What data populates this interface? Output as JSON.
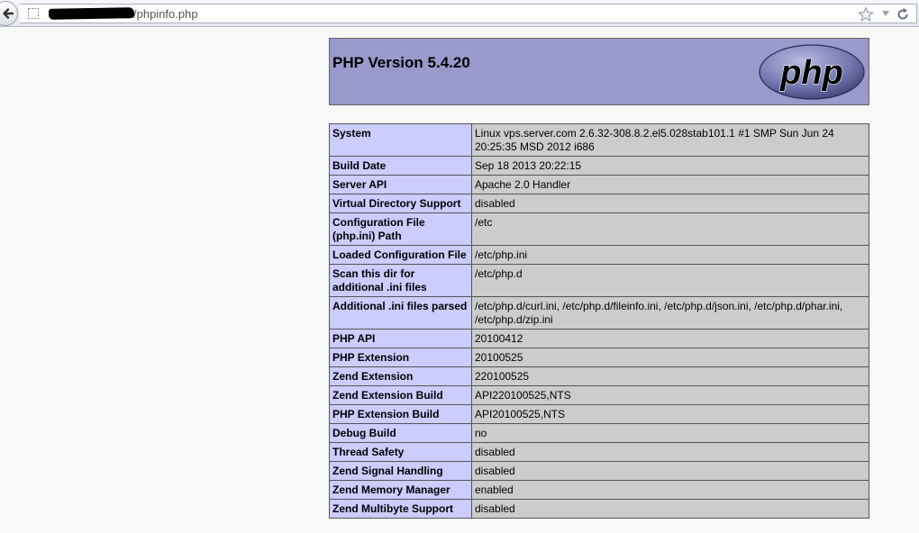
{
  "browser": {
    "url_path": "/phpinfo.php"
  },
  "header": {
    "title": "PHP Version 5.4.20",
    "logo_text": "php"
  },
  "rows": [
    {
      "key": "System",
      "value": "Linux vps.server.com 2.6.32-308.8.2.el5.028stab101.1 #1 SMP Sun Jun 24 20:25:35 MSD 2012 i686"
    },
    {
      "key": "Build Date",
      "value": "Sep 18 2013 20:22:15"
    },
    {
      "key": "Server API",
      "value": "Apache 2.0 Handler"
    },
    {
      "key": "Virtual Directory Support",
      "value": "disabled"
    },
    {
      "key": "Configuration File (php.ini) Path",
      "value": "/etc"
    },
    {
      "key": "Loaded Configuration File",
      "value": "/etc/php.ini"
    },
    {
      "key": "Scan this dir for additional .ini files",
      "value": "/etc/php.d"
    },
    {
      "key": "Additional .ini files parsed",
      "value": "/etc/php.d/curl.ini, /etc/php.d/fileinfo.ini, /etc/php.d/json.ini, /etc/php.d/phar.ini, /etc/php.d/zip.ini"
    },
    {
      "key": "PHP API",
      "value": "20100412"
    },
    {
      "key": "PHP Extension",
      "value": "20100525"
    },
    {
      "key": "Zend Extension",
      "value": "220100525"
    },
    {
      "key": "Zend Extension Build",
      "value": "API220100525,NTS"
    },
    {
      "key": "PHP Extension Build",
      "value": "API20100525,NTS"
    },
    {
      "key": "Debug Build",
      "value": "no"
    },
    {
      "key": "Thread Safety",
      "value": "disabled"
    },
    {
      "key": "Zend Signal Handling",
      "value": "disabled"
    },
    {
      "key": "Zend Memory Manager",
      "value": "enabled"
    },
    {
      "key": "Zend Multibyte Support",
      "value": "disabled"
    }
  ],
  "colors": {
    "header_bg": "#9999cc",
    "key_bg": "#ccccff",
    "value_bg": "#cccccc"
  },
  "icons": [
    "back-arrow-icon",
    "site-identity-icon",
    "bookmark-star-icon",
    "dropdown-icon",
    "reload-icon",
    "php-logo-icon"
  ]
}
